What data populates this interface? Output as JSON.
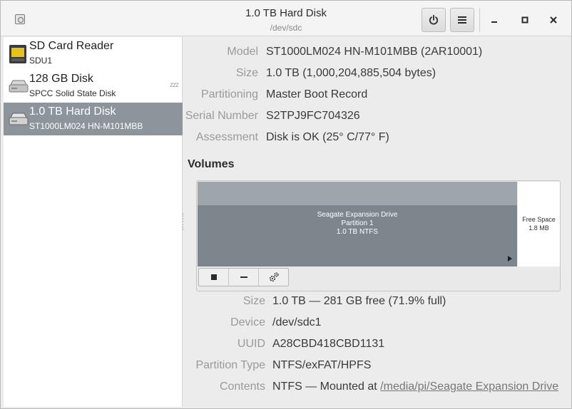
{
  "window": {
    "title": "1.0 TB Hard Disk",
    "subtitle": "/dev/sdc"
  },
  "header_buttons": {
    "power_icon": "power-icon",
    "menu_icon": "hamburger-menu-icon",
    "minimize_icon": "minimize-icon",
    "maximize_icon": "maximize-icon",
    "close_icon": "close-icon"
  },
  "sidebar": {
    "devices": [
      {
        "name": "SD Card Reader",
        "subtitle": "SDU1",
        "icon": "sd-card-icon",
        "selected": false
      },
      {
        "name": "128 GB Disk",
        "subtitle": "SPCC Solid State Disk",
        "icon": "hard-disk-icon",
        "selected": false,
        "badge": "zzz"
      },
      {
        "name": "1.0 TB Hard Disk",
        "subtitle": "ST1000LM024 HN-M101MBB",
        "icon": "hard-disk-icon",
        "selected": true
      }
    ]
  },
  "disk": {
    "model_label": "Model",
    "model_value": "ST1000LM024 HN-M101MBB (2AR10001)",
    "size_label": "Size",
    "size_value": "1.0 TB (1,000,204,885,504 bytes)",
    "partitioning_label": "Partitioning",
    "partitioning_value": "Master Boot Record",
    "serial_label": "Serial Number",
    "serial_value": "S2TPJ9FC704326",
    "assessment_label": "Assessment",
    "assessment_value": "Disk is OK (25° C/77° F)"
  },
  "volumes": {
    "heading": "Volumes",
    "partition": {
      "line1": "Seagate Expansion Drive",
      "line2": "Partition 1",
      "line3": "1.0 TB NTFS"
    },
    "free_space": {
      "line1": "Free Space",
      "line2": "1.8 MB"
    },
    "toolbar_icons": [
      "stop-icon",
      "minus-icon",
      "gears-icon"
    ]
  },
  "volume_details": {
    "size_label": "Size",
    "size_value": "1.0 TB — 281 GB free (71.9% full)",
    "device_label": "Device",
    "device_value": "/dev/sdc1",
    "uuid_label": "UUID",
    "uuid_value": "A28CBD418CBD1131",
    "ptype_label": "Partition Type",
    "ptype_value": "NTFS/exFAT/HPFS",
    "contents_label": "Contents",
    "contents_prefix": "NTFS — Mounted at ",
    "contents_link": "/media/pi/Seagate Expansion Drive"
  },
  "colors": {
    "selection": "#8c959c",
    "partition": "#7e868d",
    "partition_highlight": "#9ea5ab",
    "panel_background": "#ececec"
  }
}
